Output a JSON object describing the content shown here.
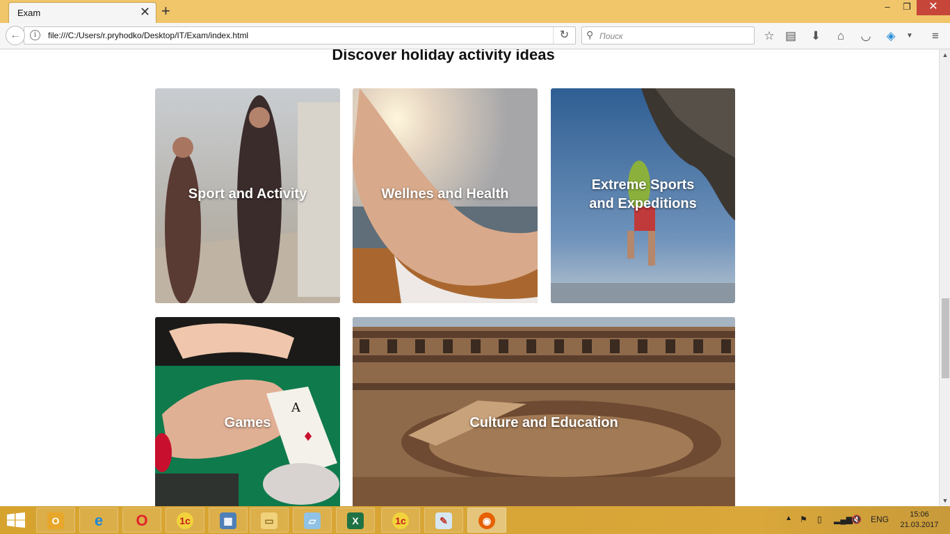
{
  "browser": {
    "tab_title": "Exam",
    "tab_close": "✕",
    "new_tab": "+",
    "url": "file:///C:/Users/r.pryhodko/Desktop/IT/Exam/index.html",
    "search_placeholder": "Поиск",
    "window_controls": {
      "minimize": "–",
      "maximize": "❐",
      "close": "✕"
    }
  },
  "page": {
    "heading": "Discover holiday activity ideas",
    "cards": [
      {
        "label_lines": [
          "Sport and Activity"
        ]
      },
      {
        "label_lines": [
          "Wellnes and Health"
        ]
      },
      {
        "label_lines": [
          "Extreme Sports",
          "and Expeditions"
        ]
      },
      {
        "label_lines": [
          "Games"
        ]
      },
      {
        "label_lines": [
          "Culture and Education"
        ]
      }
    ]
  },
  "taskbar": {
    "apps": [
      "outlook-icon",
      "internet-explorer-icon",
      "opera-icon",
      "1c-icon",
      "network-app-icon",
      "file-explorer-icon",
      "notes-app-icon",
      "excel-icon",
      "1c-icon",
      "paint-icon",
      "firefox-icon"
    ],
    "language": "ENG",
    "time": "15:06",
    "date": "21.03.2017"
  },
  "colors": {
    "titlebar": "#f1c56a",
    "taskbar": "#d7a32f",
    "close_button": "#c7463a"
  }
}
